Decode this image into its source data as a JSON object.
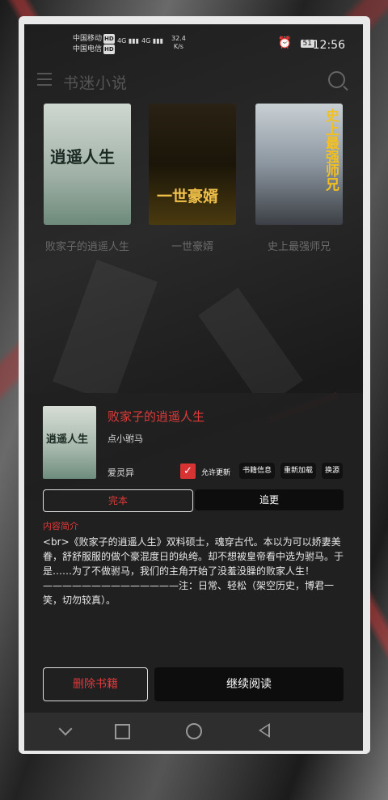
{
  "status_bar": {
    "carrier1": "中国移动",
    "carrier2": "中国电信",
    "hd": "HD",
    "signal1": "4G",
    "signal2": "4G",
    "speed_value": "32.4",
    "speed_unit": "K/s",
    "battery": "51",
    "time": "12:56"
  },
  "header": {
    "title": "书迷小说"
  },
  "books": [
    {
      "title": "败家子的逍遥人生",
      "cover_text": "逍遥人生"
    },
    {
      "title": "一世豪婿",
      "cover_text": "一世豪婿"
    },
    {
      "title": "史上最强师兄",
      "cover_text": "史上最强师兄"
    }
  ],
  "detail": {
    "title": "败家子的逍遥人生",
    "author": "点小驸马",
    "source": "爱灵异",
    "allow_update_label": "允许更新",
    "buttons": {
      "book_info": "书籍信息",
      "reload": "重新加载",
      "change_source": "换源"
    },
    "status_done": "完本",
    "status_update": "追更",
    "intro_label": "内容简介",
    "intro_text": "<br>《败家子的逍遥人生》双料硕士，魂穿古代。本以为可以娇妻美眷，舒舒服服的做个豪混度日的纨绔。却不想被皇帝看中选为驸马。于是……为了不做驸马，我们的主角开始了没羞没臊的败家人生！——————————————注：日常、轻松（架空历史，博君一笑，切勿较真）。",
    "delete_label": "删除书籍",
    "continue_label": "继续阅读"
  },
  "colors": {
    "accent": "#e03a3a",
    "sheet_bg": "#202020"
  }
}
